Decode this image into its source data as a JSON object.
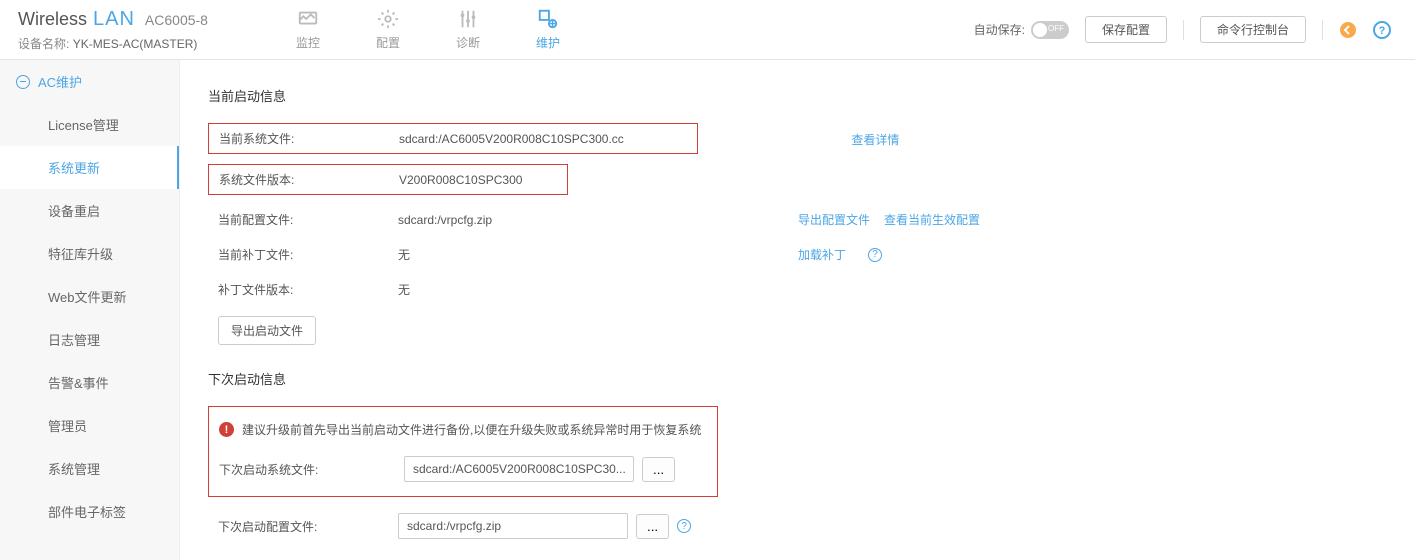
{
  "header": {
    "logo_wireless": "Wireless",
    "logo_lan": "LAN",
    "model": "AC6005-8",
    "device_label": "设备名称:",
    "device_name": "YK-MES-AC(MASTER)",
    "nav": [
      "监控",
      "配置",
      "诊断",
      "维护"
    ],
    "auto_save_label": "自动保存:",
    "save_btn": "保存配置",
    "cli_btn": "命令行控制台"
  },
  "sidebar": {
    "title": "AC维护",
    "items": [
      "License管理",
      "系统更新",
      "设备重启",
      "特征库升级",
      "Web文件更新",
      "日志管理",
      "告警&事件",
      "管理员",
      "系统管理",
      "部件电子标签"
    ]
  },
  "content": {
    "section1_title": "当前启动信息",
    "rows": {
      "cur_sys_file_lbl": "当前系统文件:",
      "cur_sys_file_val": "sdcard:/AC6005V200R008C10SPC300.cc",
      "sys_file_ver_lbl": "系统文件版本:",
      "sys_file_ver_val": "V200R008C10SPC300",
      "cur_cfg_lbl": "当前配置文件:",
      "cur_cfg_val": "sdcard:/vrpcfg.zip",
      "cur_patch_lbl": "当前补丁文件:",
      "cur_patch_val": "无",
      "patch_ver_lbl": "补丁文件版本:",
      "patch_ver_val": "无"
    },
    "links": {
      "view_detail": "查看详情",
      "export_cfg": "导出配置文件",
      "view_effective": "查看当前生效配置",
      "load_patch": "加载补丁"
    },
    "export_startup_btn": "导出启动文件",
    "section2_title": "下次启动信息",
    "alert_text": "建议升级前首先导出当前启动文件进行备份,以便在升级失败或系统异常时用于恢复系统",
    "next_sys_lbl": "下次启动系统文件:",
    "next_sys_val": "sdcard:/AC6005V200R008C10SPC30...",
    "next_cfg_lbl": "下次启动配置文件:",
    "next_cfg_val": "sdcard:/vrpcfg.zip"
  }
}
